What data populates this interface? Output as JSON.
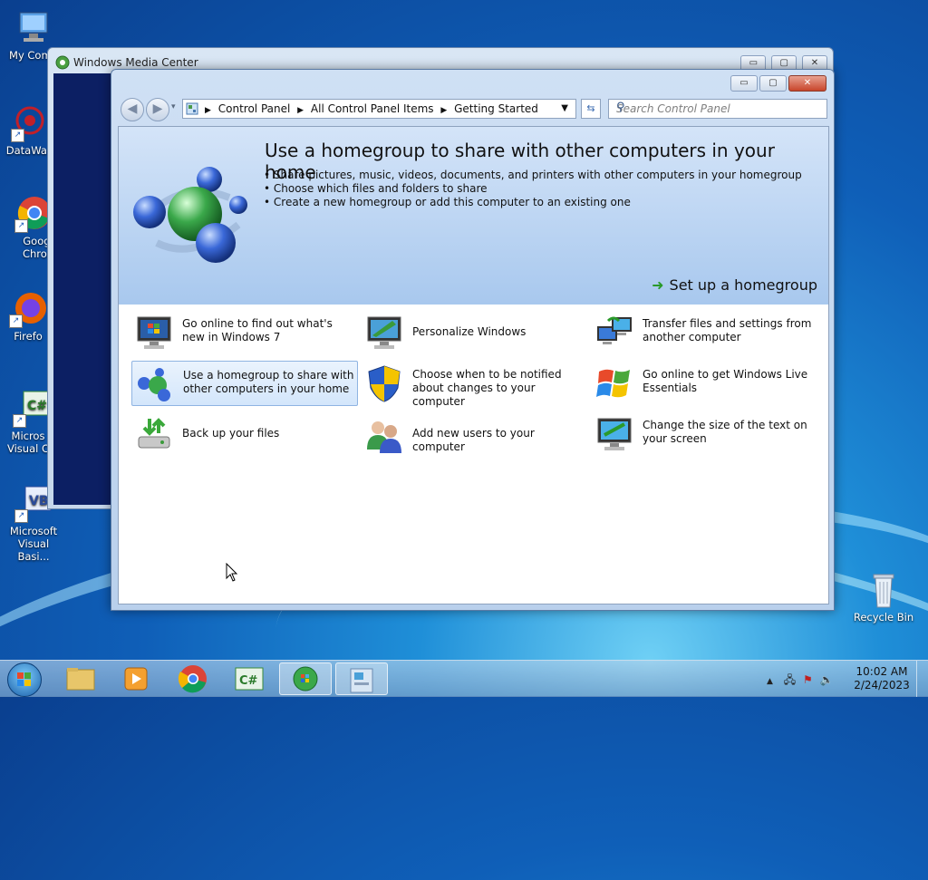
{
  "desktop": {
    "icons": [
      {
        "label": "My Comp"
      },
      {
        "label": "DataWag"
      },
      {
        "label": "Googl Chron"
      },
      {
        "label": "Firefo"
      },
      {
        "label": "Micros Visual C"
      },
      {
        "label": "Microsoft Visual Basi..."
      },
      {
        "label": "Recycle Bin"
      }
    ]
  },
  "background_window": {
    "title": "Windows Media Center"
  },
  "window": {
    "controls": {
      "minimize": "▭",
      "maximize": "▢",
      "close": "✕"
    },
    "nav": {
      "back": "◀",
      "forward": "▶",
      "breadcrumb": [
        "Control Panel",
        "All Control Panel Items",
        "Getting Started"
      ],
      "search_placeholder": "Search Control Panel"
    },
    "hero": {
      "title": "Use a homegroup to share with other computers in your home",
      "bullets": [
        "Share pictures, music, videos, documents, and printers with other computers in your homegroup",
        "Choose which files and folders to share",
        "Create a new homegroup or add this computer to an existing one"
      ],
      "action": "Set up a homegroup"
    },
    "tiles": [
      {
        "label": "Go online to find out what's new in Windows 7",
        "icon": "monitor-windows-icon"
      },
      {
        "label": "Personalize Windows",
        "icon": "personalize-icon"
      },
      {
        "label": "Transfer files and settings from another computer",
        "icon": "transfer-icon"
      },
      {
        "label": "Use a homegroup to share with other computers in your home",
        "icon": "homegroup-icon",
        "selected": true
      },
      {
        "label": "Choose when to be notified about changes to your computer",
        "icon": "uac-shield-icon"
      },
      {
        "label": "Go online to get Windows Live Essentials",
        "icon": "windows-flag-icon"
      },
      {
        "label": "Back up your files",
        "icon": "backup-icon"
      },
      {
        "label": "Add new users to your computer",
        "icon": "users-icon"
      },
      {
        "label": "Change the size of the text on your screen",
        "icon": "display-text-icon"
      }
    ]
  },
  "taskbar": {
    "apps": [
      "windows-explorer",
      "media-player",
      "chrome",
      "csharp",
      "media-center",
      "control-panel"
    ],
    "clock": {
      "time": "10:02 AM",
      "date": "2/24/2023"
    }
  }
}
